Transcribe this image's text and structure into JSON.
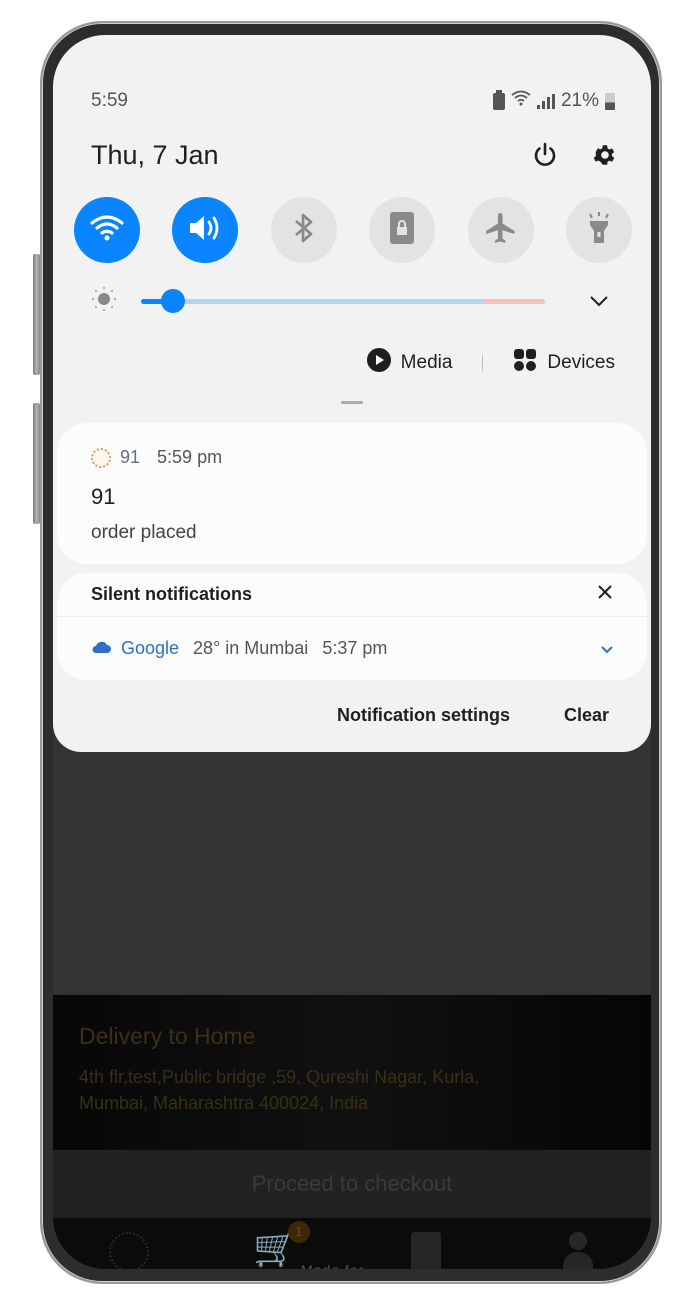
{
  "status_bar": {
    "time": "5:59",
    "battery_percent": "21%",
    "icons": [
      "battery-saver-icon",
      "wifi-icon",
      "signal-icon",
      "battery-icon"
    ]
  },
  "header": {
    "date": "Thu, 7 Jan",
    "actions": [
      "power-icon",
      "settings-icon"
    ]
  },
  "quick_toggles": [
    {
      "name": "wifi",
      "icon": "wifi-icon",
      "state": "on"
    },
    {
      "name": "sound",
      "icon": "volume-icon",
      "state": "on"
    },
    {
      "name": "bluetooth",
      "icon": "bluetooth-icon",
      "state": "off"
    },
    {
      "name": "screen-lock",
      "icon": "lock-icon",
      "state": "off"
    },
    {
      "name": "airplane-mode",
      "icon": "airplane-icon",
      "state": "off"
    },
    {
      "name": "flashlight",
      "icon": "flashlight-icon",
      "state": "off"
    }
  ],
  "brightness": {
    "value_percent": 8,
    "accent": "#0a84ff"
  },
  "media_row": {
    "media_label": "Media",
    "devices_label": "Devices"
  },
  "notification": {
    "app": "91",
    "time": "5:59 pm",
    "title": "91",
    "body": "order placed"
  },
  "silent": {
    "header": "Silent notifications",
    "item": {
      "app": "Google",
      "text": "28° in Mumbai",
      "time": "5:37 pm"
    }
  },
  "panel_actions": {
    "settings_label": "Notification settings",
    "clear_label": "Clear"
  },
  "background_app": {
    "delivery_title": "Delivery to Home",
    "delivery_address_line1": "4th flr,test,Public bridge ,59, Qureshi Nagar, Kurla,",
    "delivery_address_line2": "Mumbai, Maharashtra 400024, India",
    "checkout_label": "Proceed to checkout",
    "cart_badge": "1",
    "partial_text": "Made for ..."
  },
  "colors": {
    "accent_blue": "#0a84ff",
    "panel_bg": "#f2f2f2",
    "link_blue": "#2b6fc9"
  }
}
